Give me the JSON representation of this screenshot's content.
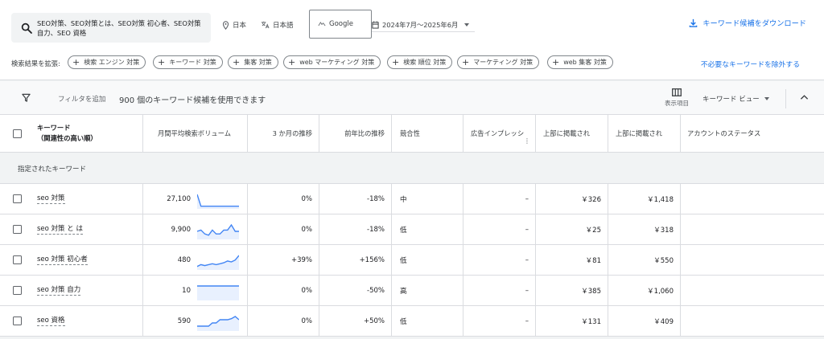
{
  "search": {
    "query": "SEO対策、SEO対策とは、SEO対策 初心者、SEO対策 自力、SEO 資格"
  },
  "location": "日本",
  "language": "日本語",
  "engine": "Google",
  "date_range": "2024年7月～2025年6月",
  "download_label": "キーワード候補をダウンロード",
  "expand_label": "検索結果を拡張:",
  "expand_chips": [
    "検索 エンジン 対策",
    "キーワード 対策",
    "集客 対策",
    "web マーケティング 対策",
    "検索 順位 対策",
    "マーケティング 対策",
    "web 集客 対策"
  ],
  "exclude_label": "不必要なキーワードを除外する",
  "filter": {
    "add_label": "フィルタを追加",
    "count_text": "900 個のキーワード候補を使用できます"
  },
  "columns_label": "表示項目",
  "view_label": "キーワード ビュー",
  "table": {
    "headers": {
      "keyword_1": "キーワード",
      "keyword_2": "（関連性の高い順）",
      "volume": "月間平均検索ボリューム",
      "three_month": "3 か月の推移",
      "yoy": "前年比の推移",
      "competition": "競合性",
      "impression": "広告インプレッシ",
      "impression_dots": "⋮",
      "bid_low": "上部に掲載され",
      "bid_high": "上部に掲載され",
      "account_status": "アカウントのステータス"
    },
    "group_label": "指定されたキーワード",
    "rows": [
      {
        "keyword": "seo 対策",
        "volume": "27,100",
        "three_month": "0%",
        "yoy": "-18%",
        "competition": "中",
        "impression": "–",
        "bid_low": "￥326",
        "bid_high": "￥1,418",
        "trend": [
          12,
          1,
          1,
          1,
          1,
          1,
          1,
          1,
          1,
          1,
          1,
          1
        ]
      },
      {
        "keyword": "seo 対策 と は",
        "volume": "9,900",
        "three_month": "0%",
        "yoy": "-18%",
        "competition": "低",
        "impression": "–",
        "bid_low": "￥25",
        "bid_high": "￥318",
        "trend": [
          5,
          6,
          3,
          2,
          6,
          3,
          3,
          6,
          6,
          10,
          5,
          5
        ]
      },
      {
        "keyword": "seo 対策 初心者",
        "volume": "480",
        "three_month": "+39%",
        "yoy": "+156%",
        "competition": "低",
        "impression": "–",
        "bid_low": "￥81",
        "bid_high": "￥550",
        "trend": [
          2,
          4,
          3,
          4,
          5,
          4,
          5,
          6,
          8,
          7,
          9,
          14
        ]
      },
      {
        "keyword": "seo 対策 自力",
        "volume": "10",
        "three_month": "0%",
        "yoy": "-50%",
        "competition": "高",
        "impression": "–",
        "bid_low": "￥385",
        "bid_high": "￥1,060",
        "trend": [
          5,
          5,
          5,
          5,
          5,
          5,
          5,
          5,
          5,
          5,
          5,
          5
        ]
      },
      {
        "keyword": "seo 資格",
        "volume": "590",
        "three_month": "0%",
        "yoy": "+50%",
        "competition": "低",
        "impression": "–",
        "bid_low": "￥131",
        "bid_high": "￥409",
        "trend": [
          3,
          3,
          3,
          3,
          6,
          6,
          9,
          9,
          9,
          10,
          12,
          9
        ]
      }
    ]
  },
  "colors": {
    "accent": "#1a73e8",
    "spark_line": "#4285f4",
    "spark_fill": "#e8f0fe"
  },
  "icons": [
    "search-icon",
    "location-pin-icon",
    "translate-icon",
    "engine-icon",
    "calendar-icon",
    "download-icon",
    "plus-icon",
    "filter-icon",
    "columns-icon",
    "chevron-up-icon"
  ]
}
